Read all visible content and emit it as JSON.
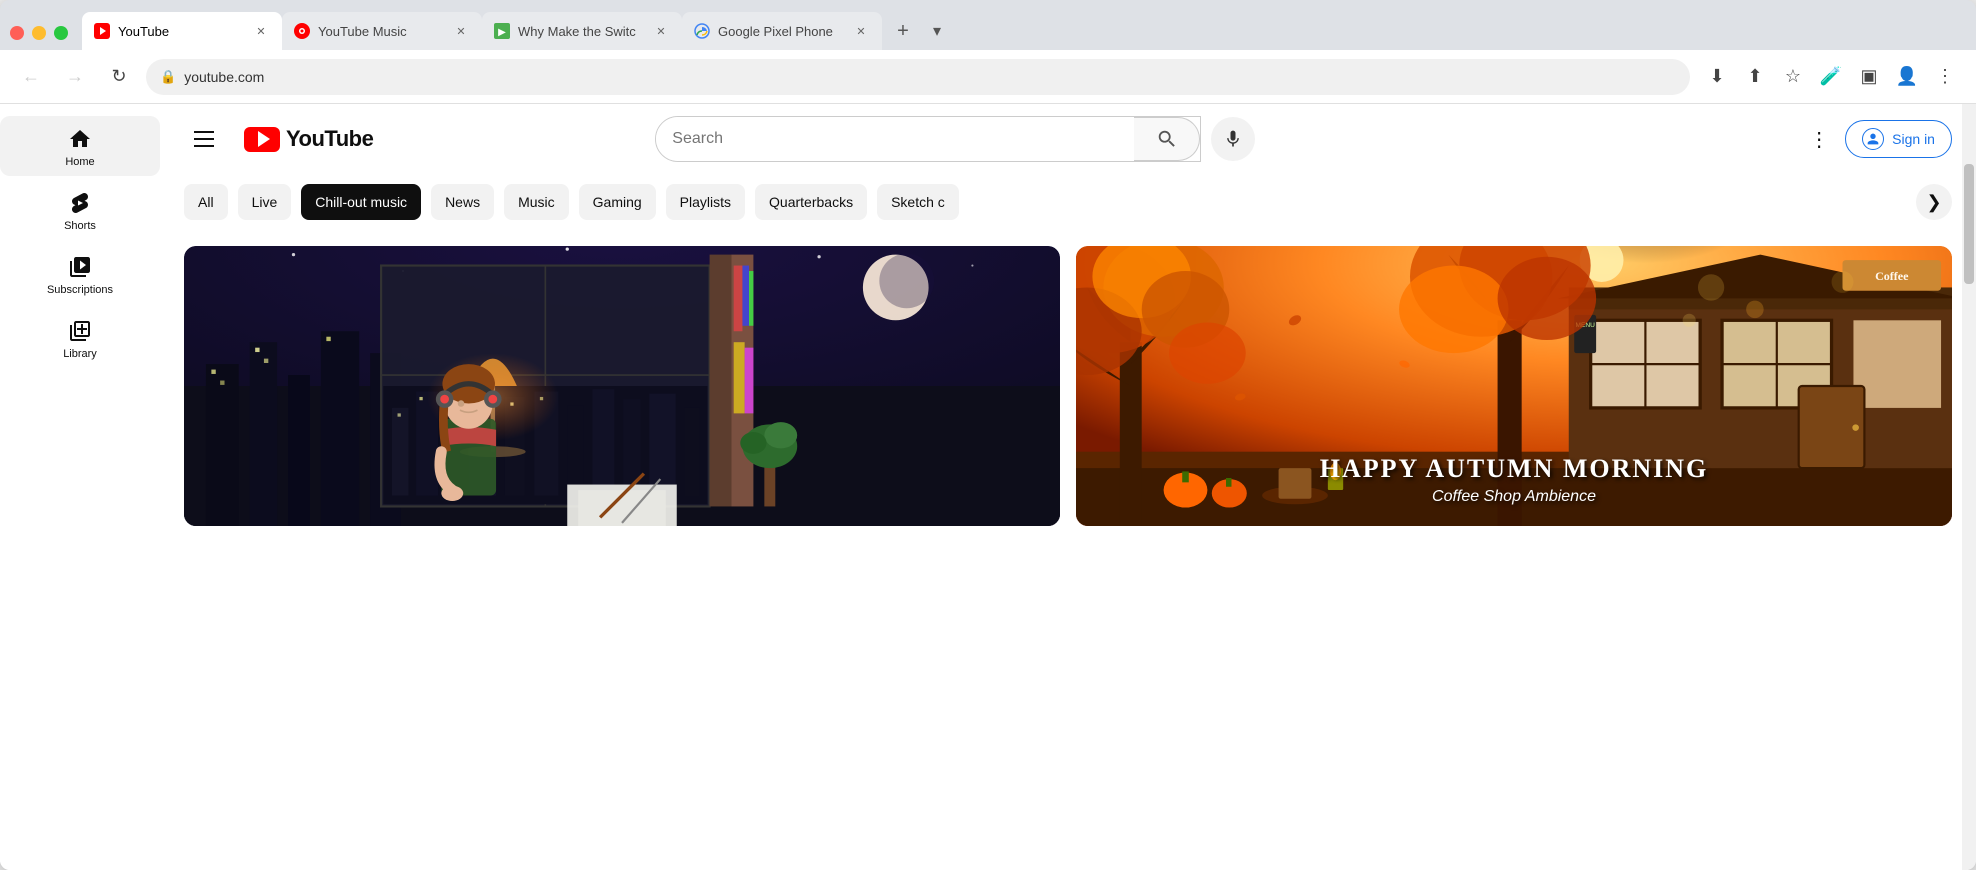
{
  "browser": {
    "tabs": [
      {
        "id": "tab-youtube",
        "title": "YouTube",
        "favicon_type": "youtube",
        "active": true,
        "url": "youtube.com"
      },
      {
        "id": "tab-youtube-music",
        "title": "YouTube Music",
        "favicon_type": "youtube-music",
        "active": false
      },
      {
        "id": "tab-why-switch",
        "title": "Why Make the Switc",
        "favicon_type": "green",
        "active": false
      },
      {
        "id": "tab-google-pixel",
        "title": "Google Pixel Phone",
        "favicon_type": "google",
        "active": false
      }
    ],
    "address": "youtube.com",
    "new_tab_label": "+",
    "overflow_label": "▾"
  },
  "youtube": {
    "logo_text": "YouTube",
    "search_placeholder": "Search",
    "sign_in_label": "Sign in",
    "filter_chips": [
      {
        "id": "all",
        "label": "All",
        "active": false
      },
      {
        "id": "live",
        "label": "Live",
        "active": false
      },
      {
        "id": "chill-out-music",
        "label": "Chill-out music",
        "active": true
      },
      {
        "id": "news",
        "label": "News",
        "active": false
      },
      {
        "id": "music",
        "label": "Music",
        "active": false
      },
      {
        "id": "gaming",
        "label": "Gaming",
        "active": false
      },
      {
        "id": "playlists",
        "label": "Playlists",
        "active": false
      },
      {
        "id": "quarterbacks",
        "label": "Quarterbacks",
        "active": false
      },
      {
        "id": "sketch",
        "label": "Sketch c",
        "active": false
      }
    ],
    "sidebar": {
      "items": [
        {
          "id": "home",
          "label": "Home",
          "icon": "home",
          "active": true
        },
        {
          "id": "shorts",
          "label": "Shorts",
          "icon": "shorts",
          "active": false
        },
        {
          "id": "subscriptions",
          "label": "Subscriptions",
          "icon": "subscriptions",
          "active": false
        }
      ]
    },
    "videos": [
      {
        "id": "video-1",
        "type": "lofi",
        "overlay_title": "",
        "overlay_subtitle": ""
      },
      {
        "id": "video-2",
        "type": "autumn",
        "overlay_title": "HAPPY AUTUMN MORNING",
        "overlay_subtitle": "Coffee Shop Ambience"
      }
    ]
  },
  "nav": {
    "back_label": "←",
    "forward_label": "→",
    "refresh_label": "↻"
  }
}
